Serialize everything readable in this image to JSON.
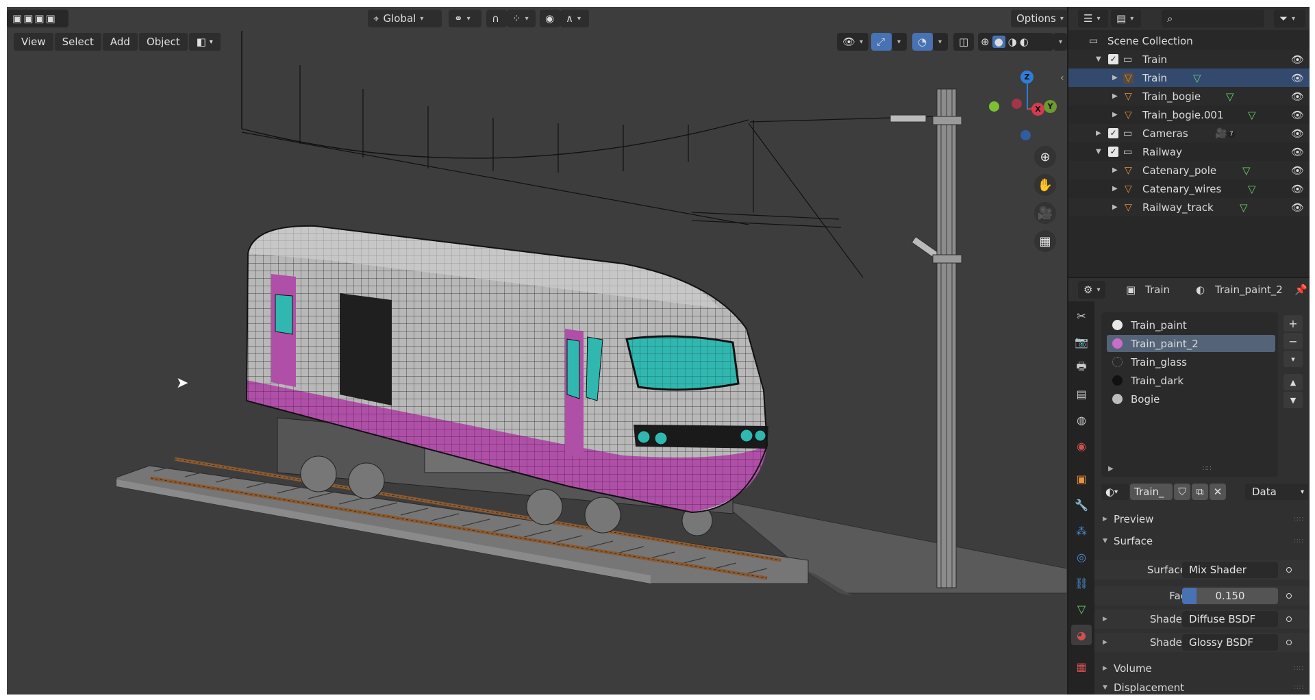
{
  "viewport": {
    "menu": [
      "View",
      "Select",
      "Add",
      "Object"
    ],
    "orientation_label": "Global",
    "options_label": "Options",
    "gizmo": {
      "x": "X",
      "y": "Y",
      "z": "Z"
    }
  },
  "outliner": {
    "search_placeholder": "",
    "rows": [
      {
        "label": "Scene Collection",
        "type": "scene"
      },
      {
        "label": "Train",
        "type": "collection"
      },
      {
        "label": "Train",
        "type": "object"
      },
      {
        "label": "Train_bogie",
        "type": "object"
      },
      {
        "label": "Train_bogie.001",
        "type": "object"
      },
      {
        "label": "Cameras",
        "type": "collection",
        "badge": "7"
      },
      {
        "label": "Railway",
        "type": "collection"
      },
      {
        "label": "Catenary_pole",
        "type": "object"
      },
      {
        "label": "Catenary_wires",
        "type": "object"
      },
      {
        "label": "Railway_track",
        "type": "object"
      }
    ]
  },
  "properties": {
    "breadcrumb": {
      "object": "Train",
      "material": "Train_paint_2"
    },
    "materials": [
      {
        "name": "Train_paint",
        "color": "#e8e8e8"
      },
      {
        "name": "Train_paint_2",
        "color": "#c86ec8",
        "selected": true
      },
      {
        "name": "Train_glass",
        "color": "#888888"
      },
      {
        "name": "Train_dark",
        "color": "#111111"
      },
      {
        "name": "Bogie",
        "color": "#bdbdbd"
      }
    ],
    "slot_name": "Train_",
    "link_label": "Data",
    "panels": {
      "preview": "Preview",
      "surface": "Surface",
      "volume": "Volume",
      "displacement": "Displacement"
    },
    "surface_label": "Surface",
    "surface_value": "Mix Shader",
    "fac_label": "Fac",
    "fac_value": "0.150",
    "fac_fraction": 0.15,
    "shader_label": "Shader",
    "shader1_value": "Diffuse BSDF",
    "shader2_value": "Glossy BSDF"
  },
  "colors": {
    "accent": "#4772b3",
    "magenta": "#b04fa8",
    "teal": "#2fb7b0",
    "object_orange": "#e8923a"
  }
}
